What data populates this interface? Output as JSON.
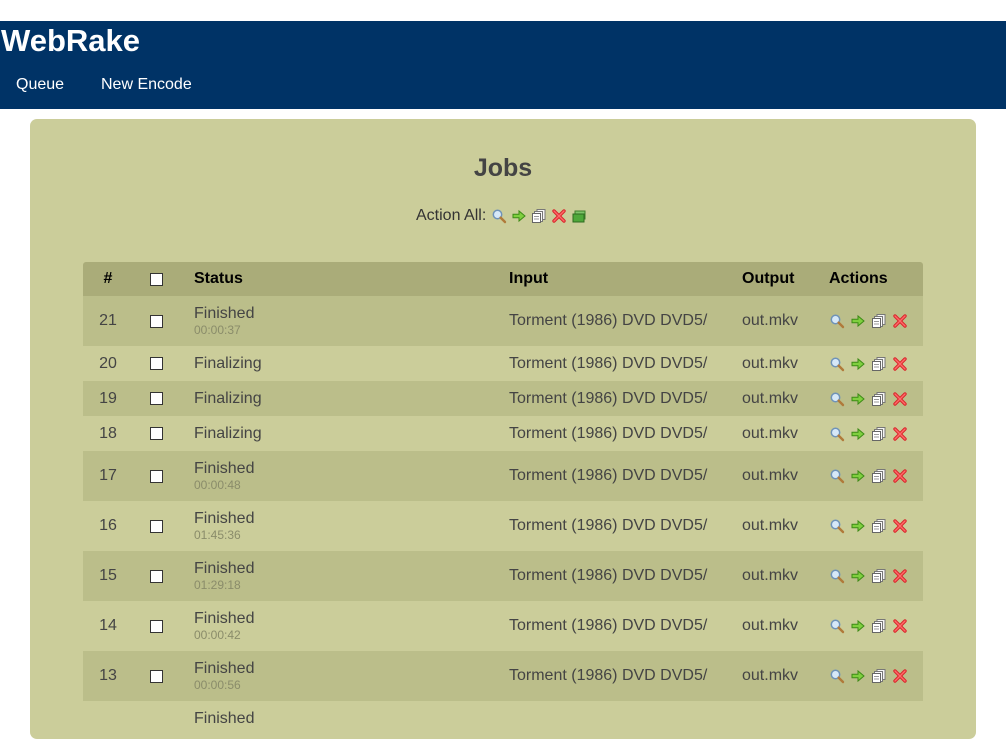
{
  "app": {
    "title": "WebRake"
  },
  "nav": {
    "items": [
      {
        "label": "Queue"
      },
      {
        "label": "New Encode"
      }
    ]
  },
  "page": {
    "title": "Jobs",
    "action_all_label": "Action All:"
  },
  "icons": {
    "view": "magnifier-icon",
    "start": "green-arrow-icon",
    "log": "document-stack-icon",
    "delete": "red-x-icon",
    "clear": "green-stack-icon"
  },
  "colors": {
    "header_bg": "#003366",
    "panel_bg": "#cbcd9a",
    "row_alt_bg": "#bbbe8a",
    "table_head_bg": "#aaac79"
  },
  "table": {
    "columns": {
      "num": "#",
      "status": "Status",
      "input": "Input",
      "output": "Output",
      "actions": "Actions"
    },
    "rows": [
      {
        "id": "21",
        "status": "Finished",
        "time": "00:00:37",
        "input": "Torment (1986) DVD DVD5/",
        "output": "out.mkv"
      },
      {
        "id": "20",
        "status": "Finalizing",
        "time": "",
        "input": "Torment (1986) DVD DVD5/",
        "output": "out.mkv"
      },
      {
        "id": "19",
        "status": "Finalizing",
        "time": "",
        "input": "Torment (1986) DVD DVD5/",
        "output": "out.mkv"
      },
      {
        "id": "18",
        "status": "Finalizing",
        "time": "",
        "input": "Torment (1986) DVD DVD5/",
        "output": "out.mkv"
      },
      {
        "id": "17",
        "status": "Finished",
        "time": "00:00:48",
        "input": "Torment (1986) DVD DVD5/",
        "output": "out.mkv"
      },
      {
        "id": "16",
        "status": "Finished",
        "time": "01:45:36",
        "input": "Torment (1986) DVD DVD5/",
        "output": "out.mkv"
      },
      {
        "id": "15",
        "status": "Finished",
        "time": "01:29:18",
        "input": "Torment (1986) DVD DVD5/",
        "output": "out.mkv"
      },
      {
        "id": "14",
        "status": "Finished",
        "time": "00:00:42",
        "input": "Torment (1986) DVD DVD5/",
        "output": "out.mkv"
      },
      {
        "id": "13",
        "status": "Finished",
        "time": "00:00:56",
        "input": "Torment (1986) DVD DVD5/",
        "output": "out.mkv"
      },
      {
        "id": "",
        "status": "Finished",
        "time": "",
        "input": "",
        "output": ""
      }
    ]
  }
}
